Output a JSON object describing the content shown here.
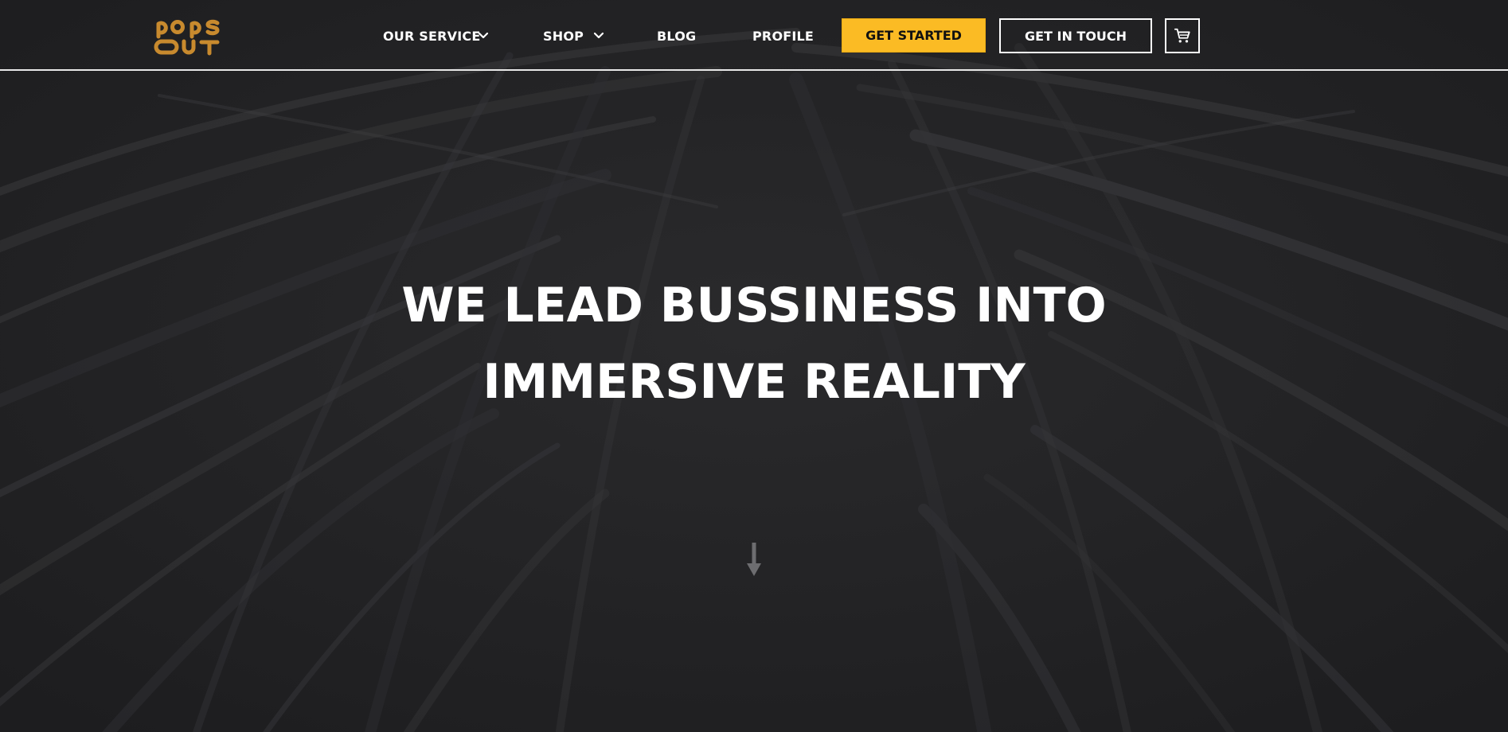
{
  "brand": {
    "logo_text_top": "pops",
    "logo_text_bottom": "OUT",
    "logo_color": "#c88a2e"
  },
  "nav": {
    "items": [
      {
        "label": "OUR SERVICE",
        "has_dropdown": true
      },
      {
        "label": "SHOP",
        "has_dropdown": true
      },
      {
        "label": "BLOG",
        "has_dropdown": false
      },
      {
        "label": "PROFILE",
        "has_dropdown": false
      }
    ]
  },
  "actions": {
    "get_started_label": "GET STARTED",
    "get_in_touch_label": "GET IN TOUCH",
    "cart_icon": "cart-icon",
    "accent_color": "#fbbb24"
  },
  "hero": {
    "line1": "WE LEAD BUSSINESS INTO",
    "line2": "IMMERSIVE REALITY",
    "scroll_icon": "arrow-down-icon"
  }
}
